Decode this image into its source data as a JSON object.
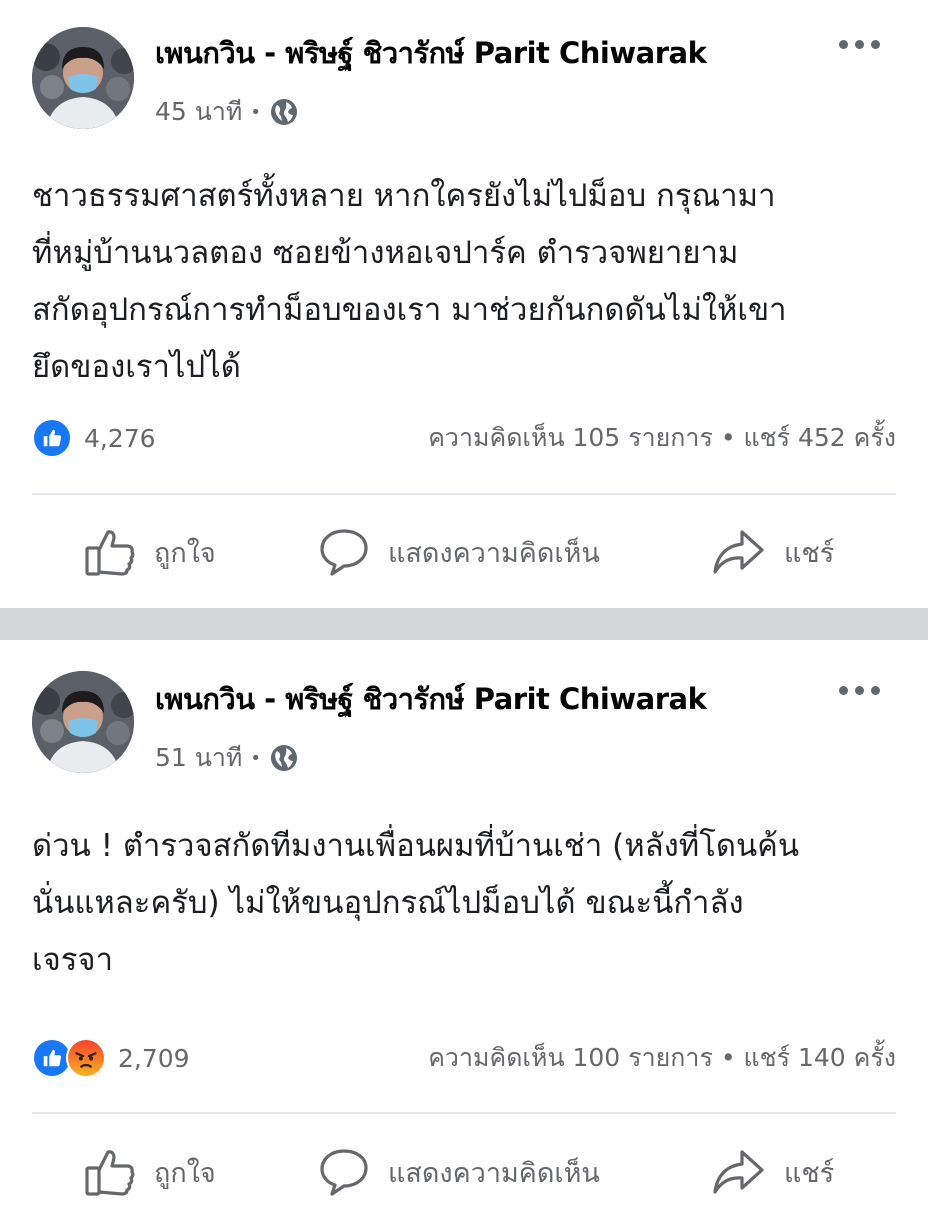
{
  "posts": [
    {
      "author": "เพนกวิน - พริษฐ์ ชิวารักษ์ Parit Chiwarak",
      "time": "45 นาที",
      "privacy_icon": "globe-icon",
      "text": "ชาวธรรมศาสตร์ทั้งหลาย หากใครยังไม่ไปม็อบ กรุณามา\nที่หมู่บ้านนวลตอง ซอยข้างหอเจปาร์ค ตำรวจพยายาม\nสกัดอุปกรณ์การทำม็อบของเรา มาช่วยกันกดดันไม่ให้เขา\nยึดของเราไปได้",
      "reactions": [
        "like"
      ],
      "reaction_count": "4,276",
      "stats": "ความคิดเห็น 105 รายการ • แชร์ 452 ครั้ง",
      "actions": {
        "like": "ถูกใจ",
        "comment": "แสดงความคิดเห็น",
        "share": "แชร์"
      }
    },
    {
      "author": "เพนกวิน - พริษฐ์ ชิวารักษ์ Parit Chiwarak",
      "time": "51 นาที",
      "privacy_icon": "globe-icon",
      "text": "ด่วน ! ตำรวจสกัดทีมงานเพื่อนผมที่บ้านเช่า (หลังที่โดนค้น\nนั่นแหละครับ) ไม่ให้ขนอุปกรณ์ไปม็อบได้ ขณะนี้กำลัง\nเจรจา",
      "reactions": [
        "like",
        "angry"
      ],
      "reaction_count": "2,709",
      "stats": "ความคิดเห็น 100 รายการ • แชร์ 140 ครั้ง",
      "actions": {
        "like": "ถูกใจ",
        "comment": "แสดงความคิดเห็น",
        "share": "แชร์"
      }
    }
  ],
  "colors": {
    "like_blue": "#1877f2",
    "muted_text": "#65676b",
    "separator": "#d5d6d9"
  }
}
